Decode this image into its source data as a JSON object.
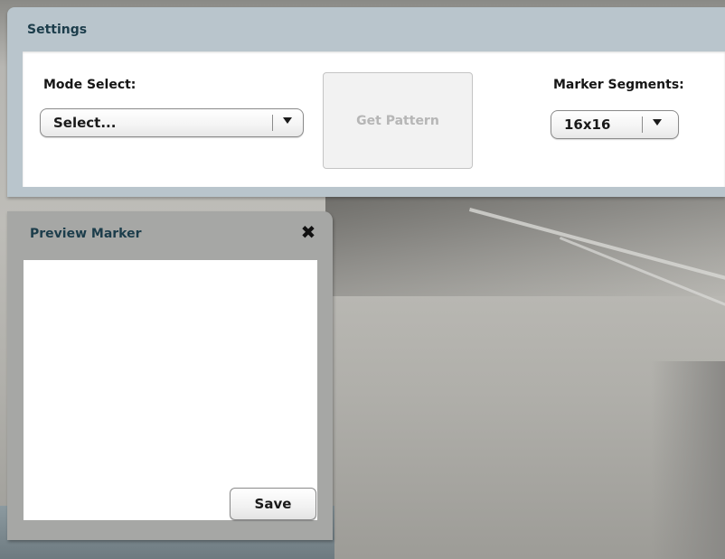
{
  "settings": {
    "title": "Settings",
    "mode_select": {
      "label": "Mode Select:",
      "value": "Select..."
    },
    "get_pattern_label": "Get Pattern",
    "marker_segments": {
      "label": "Marker Segments:",
      "value": "16x16"
    }
  },
  "preview": {
    "title": "Preview Marker",
    "close_icon": "✖",
    "save_label": "Save"
  }
}
